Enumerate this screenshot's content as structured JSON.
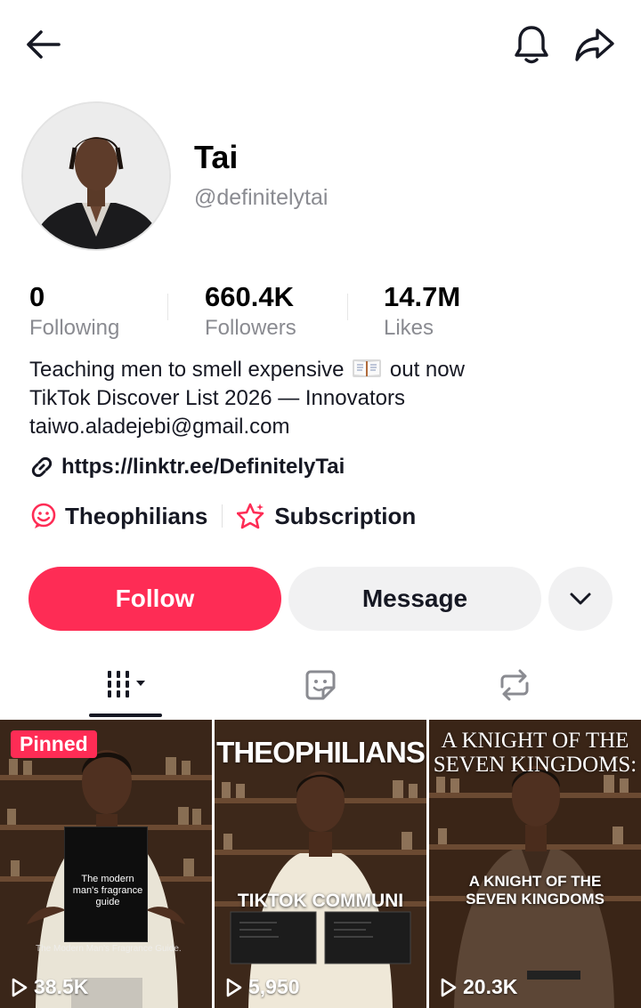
{
  "header": {
    "back_icon": "arrow-left-icon",
    "notifications_icon": "bell-icon",
    "share_icon": "share-arrow-icon"
  },
  "profile": {
    "display_name": "Tai",
    "username": "@definitelytai",
    "avatar": "profile-photo"
  },
  "stats": [
    {
      "value": "0",
      "label": "Following"
    },
    {
      "value": "660.4K",
      "label": "Followers"
    },
    {
      "value": "14.7M",
      "label": "Likes"
    }
  ],
  "bio": {
    "line1_before": "Teaching men to smell expensive",
    "line1_icon": "open-book-emoji",
    "line1_after": "out now",
    "line2": "TikTok Discover List 2026 — Innovators",
    "line3": "taiwo.aladejebi@gmail.com"
  },
  "link": {
    "icon": "link-icon",
    "text": "https://linktr.ee/DefinitelyTai"
  },
  "chips": [
    {
      "icon": "community-icon",
      "label": "Theophilians"
    },
    {
      "icon": "subscription-star-icon",
      "label": "Subscription"
    }
  ],
  "actions": {
    "follow_label": "Follow",
    "message_label": "Message",
    "more_icon": "chevron-down-icon"
  },
  "tabs": [
    {
      "icon": "grid-videos-icon",
      "active": true
    },
    {
      "icon": "sticker-icon",
      "active": false
    },
    {
      "icon": "repost-icon",
      "active": false
    }
  ],
  "videos": [
    {
      "pinned_label": "Pinned",
      "views": "38.5K",
      "book_title": "The modern man's fragrance guide",
      "caption": "The Modern Man's Fragrance Guide."
    },
    {
      "title": "THEOPHILIANS",
      "subtitle": "TIKTOK COMMUNI",
      "views": "5,950"
    },
    {
      "title_line1": "A KNIGHT OF THE",
      "title_line2": "SEVEN KINGDOMS:",
      "subtitle_line1": "A KNIGHT OF THE",
      "subtitle_line2": "SEVEN KINGDOMS",
      "views": "20.3K"
    }
  ],
  "colors": {
    "accent": "#fe2c55",
    "text_primary": "#161823",
    "text_secondary": "#8a8b91",
    "button_gray": "#f1f1f2"
  }
}
